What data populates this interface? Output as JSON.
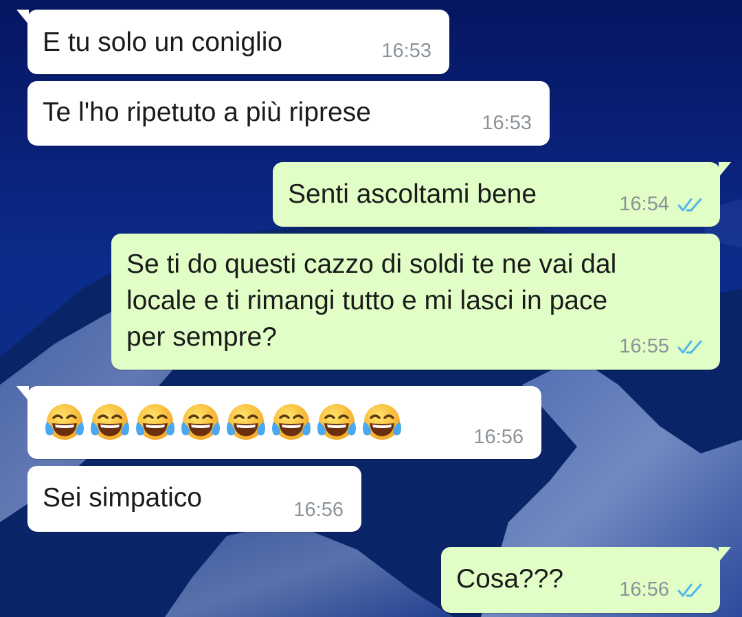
{
  "theme": {
    "incoming_bg": "#ffffff",
    "outgoing_bg": "#e1fec6",
    "time_color": "#8b9399",
    "tick_color": "#4fb6ec",
    "wallpaper": "blue snowy mountains at night"
  },
  "messages": [
    {
      "direction": "incoming",
      "text": "E tu solo un coniglio",
      "time": "16:53"
    },
    {
      "direction": "incoming",
      "text": "Te l'ho ripetuto a più riprese",
      "time": "16:53"
    },
    {
      "direction": "outgoing",
      "text": "Senti ascoltami bene",
      "time": "16:54",
      "status": "read-double-check-icon"
    },
    {
      "direction": "outgoing",
      "text": "Se ti do questi cazzo di soldi te ne vai dal\nlocale e ti rimangi tutto e mi lasci in pace\nper sempre?",
      "time": "16:55",
      "status": "read-double-check-icon"
    },
    {
      "direction": "incoming",
      "text": "😂😂😂😂😂😂😂😂",
      "emoji_name": "face-with-tears-of-joy-icon",
      "emoji_count": 8,
      "time": "16:56"
    },
    {
      "direction": "incoming",
      "text": "Sei simpatico",
      "time": "16:56"
    },
    {
      "direction": "outgoing",
      "text": "Cosa???",
      "time": "16:56",
      "status": "read-double-check-icon"
    }
  ]
}
